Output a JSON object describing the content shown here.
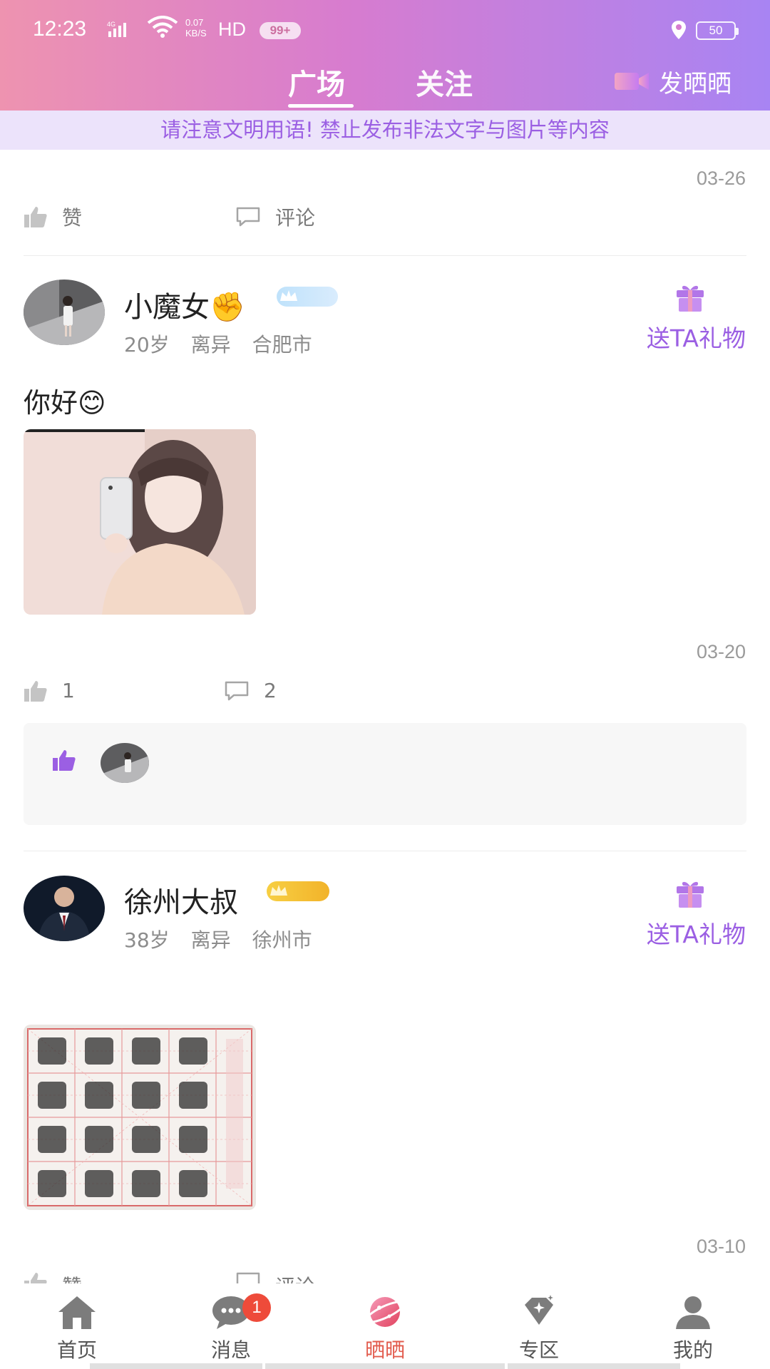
{
  "status_bar": {
    "time": "12:23",
    "signal": "4G",
    "speed_top": "0.07",
    "speed_bottom": "KB/S",
    "hd": "HD",
    "notif_badge": "99+",
    "battery": "50"
  },
  "header": {
    "tabs": [
      {
        "label": "广场",
        "active": true
      },
      {
        "label": "关注",
        "active": false
      }
    ],
    "post_button": "发晒晒",
    "notice": "请注意文明用语! 禁止发布非法文字与图片等内容"
  },
  "feed": {
    "partial_post": {
      "date": "03-26",
      "like_label": "赞",
      "comment_label": "评论"
    },
    "posts": [
      {
        "username": "小魔女",
        "name_emoji": "✊",
        "age": "20岁",
        "status": "离异",
        "city": "合肥市",
        "gift_label": "送TA礼物",
        "text": "你好😊",
        "date": "03-20",
        "like_count": "1",
        "comment_count": "2"
      },
      {
        "username": "徐州大叔",
        "age": "38岁",
        "status": "离异",
        "city": "徐州市",
        "gift_label": "送TA礼物",
        "text": "",
        "date": "03-10",
        "like_label": "赞",
        "comment_label": "评论"
      }
    ]
  },
  "bottom_nav": {
    "items": [
      {
        "label": "首页",
        "icon": "home-icon"
      },
      {
        "label": "消息",
        "icon": "message-icon",
        "badge": "1"
      },
      {
        "label": "晒晒",
        "icon": "planet-icon",
        "active": true
      },
      {
        "label": "专区",
        "icon": "diamond-icon"
      },
      {
        "label": "我的",
        "icon": "profile-icon"
      }
    ]
  },
  "colors": {
    "accent_purple": "#9b5fe3",
    "active_nav": "#e25b4d",
    "header_gradient_start": "#ee93b0",
    "header_gradient_end": "#a884f3"
  }
}
